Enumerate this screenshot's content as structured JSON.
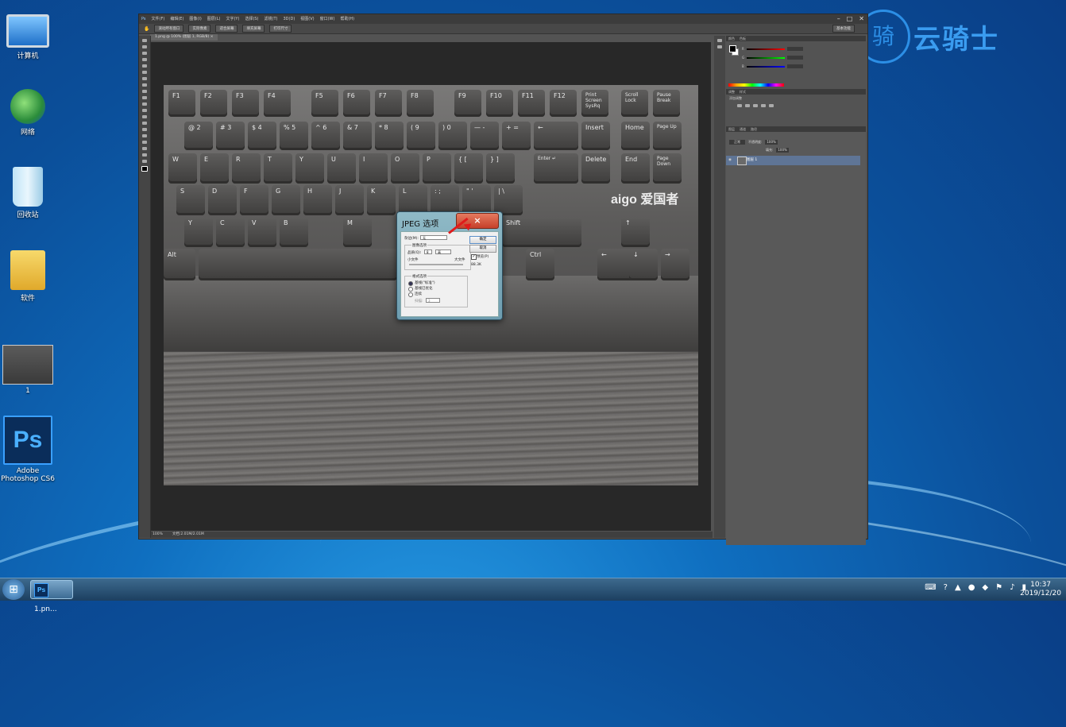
{
  "desktop": {
    "icons": [
      {
        "label": "计算机",
        "icon": "computer-icon"
      },
      {
        "label": "网络",
        "icon": "network-icon"
      },
      {
        "label": "回收站",
        "icon": "recycle-bin-icon"
      },
      {
        "label": "软件",
        "icon": "folder-icon"
      },
      {
        "label": "1",
        "icon": "image-file-icon"
      },
      {
        "label": "Adobe Photoshop CS6",
        "icon": "photoshop-icon"
      }
    ],
    "watermark": {
      "symbol": "骑",
      "text": "云骑士"
    }
  },
  "photoshop": {
    "menu": [
      "文件(F)",
      "编辑(E)",
      "图像(I)",
      "图层(L)",
      "文字(Y)",
      "选择(S)",
      "滤镜(T)",
      "3D(D)",
      "视图(V)",
      "窗口(W)",
      "帮助(H)"
    ],
    "options": [
      "滚动所有窗口",
      "实际像素",
      "适合屏幕",
      "填充屏幕",
      "打印尺寸"
    ],
    "workspace": "基本功能",
    "doc_tab": "1.png @ 100% (图层 1, RGB/8) ×",
    "status_zoom": "100%",
    "status_doc": "文档:2.01M/2.01M",
    "panels": {
      "color_tabs": [
        "颜色",
        "色板"
      ],
      "adjust_tabs": [
        "调整",
        "样式"
      ],
      "adjust_label": "添加调整",
      "layers_tabs": [
        "图层",
        "通道",
        "路径"
      ],
      "blend_mode": "正常",
      "opacity_label": "不透明度:",
      "opacity": "100%",
      "fill_label": "填充:",
      "fill": "100%",
      "layer_name": "图层 1"
    },
    "photo": {
      "keys_row1": [
        "F1",
        "F2",
        "F3",
        "F4",
        "F5",
        "F6",
        "F7",
        "F8",
        "F9",
        "F10",
        "F11",
        "F12",
        "Print Screen SysRq",
        "Scroll Lock",
        "Pause Break"
      ],
      "keys_row2": [
        "@ 2",
        "# 3",
        "$ 4",
        "% 5",
        "^ 6",
        "& 7",
        "* 8",
        "( 9",
        ") 0",
        "— -",
        "+ =",
        "←",
        "Insert",
        "Home",
        "Page Up"
      ],
      "keys_row3": [
        "W",
        "E",
        "R",
        "T",
        "Y",
        "U",
        "I",
        "O",
        "P",
        "{ [",
        "} ]",
        "Enter ↵",
        "Delete",
        "End",
        "Page Down"
      ],
      "keys_row4": [
        "S",
        "D",
        "F",
        "G",
        "H",
        "J",
        "K",
        "L",
        ": ;",
        "\" '",
        "| \\"
      ],
      "keys_row5": [
        "Y",
        "C",
        "V",
        "B",
        "M",
        "Shift",
        "↑"
      ],
      "keys_row6": [
        "Alt",
        "Ctrl",
        "←",
        "↓",
        "→"
      ],
      "brand": "aigo 爱国者"
    }
  },
  "dialog": {
    "title": "JPEG 选项",
    "close": "×",
    "matte_label": "杂边(M):",
    "matte_value": "无",
    "image_options": "图像选项",
    "quality_label": "品质(Q):",
    "quality_value": "8",
    "quality_level": "高",
    "small_file": "小文件",
    "large_file": "大文件",
    "format_options": "格式选项",
    "baseline_std": "基线(\"标准\")",
    "baseline_opt": "基线已优化",
    "progressive": "连续",
    "scans_label": "扫描:",
    "scans_value": "3",
    "ok": "确定",
    "cancel": "取消",
    "preview": "预览(P)",
    "size": "88.3K"
  },
  "taskbar": {
    "start": "⊞",
    "item": "1.pn...",
    "time": "10:37",
    "date": "2019/12/20"
  }
}
